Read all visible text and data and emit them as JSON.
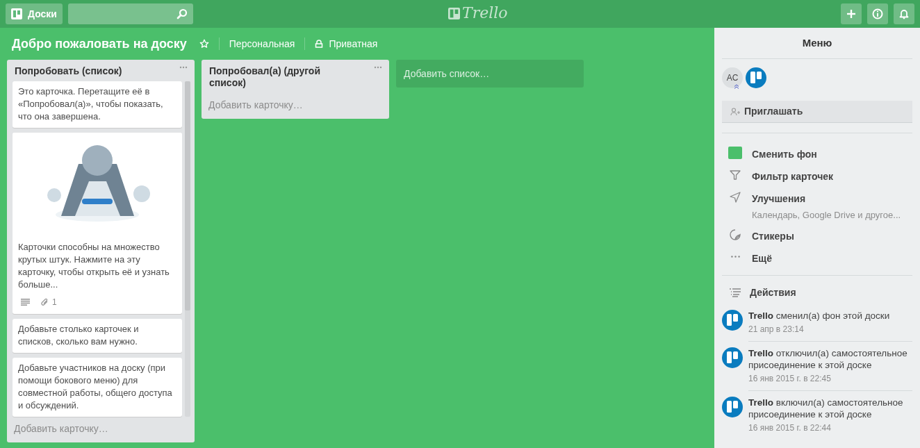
{
  "header": {
    "boards_button": "Доски",
    "logo": "Trello"
  },
  "board": {
    "title": "Добро пожаловать на доску",
    "team": "Персональная",
    "visibility": "Приватная"
  },
  "lists": [
    {
      "title": "Попробовать (список)",
      "cards": [
        {
          "kind": "text",
          "text": "Это карточка. Перетащите её в «Попробовал(а)», чтобы показать, что она завершена."
        },
        {
          "kind": "cover",
          "text": "Карточки способны на множество крутых штук. Нажмите на эту карточку, чтобы открыть её и узнать больше...",
          "description": true,
          "attachments": "1"
        },
        {
          "kind": "text",
          "text": "Добавьте столько карточек и списков, сколько вам нужно."
        },
        {
          "kind": "text",
          "text": "Добавьте участников на доску (при помощи бокового меню) для совместной работы, общего доступа и обсуждений."
        }
      ],
      "add_card": "Добавить карточку…"
    },
    {
      "title": "Попробовал(а) (другой список)",
      "add_card": "Добавить карточку…"
    }
  ],
  "add_list": "Добавить список…",
  "sidebar": {
    "title": "Меню",
    "members": [
      {
        "kind": "initials",
        "initials": "AC"
      },
      {
        "kind": "logo"
      }
    ],
    "invite": "Приглашать",
    "menu": [
      {
        "kind": "color",
        "label": "Сменить фон",
        "color": "#4bbf6b"
      },
      {
        "kind": "filter",
        "label": "Фильтр карточек"
      },
      {
        "kind": "powerups",
        "label": "Улучшения",
        "subtitle": "Календарь, Google Drive и другое..."
      },
      {
        "kind": "stickers",
        "label": "Стикеры"
      },
      {
        "kind": "more",
        "label": "Ещё"
      }
    ],
    "activity_title": "Действия",
    "activities": [
      {
        "author": "Trello",
        "text": "сменил(а) фон этой доски",
        "time": "21 апр в 23:14"
      },
      {
        "author": "Trello",
        "text": "отключил(а) самостоятельное присоединение к этой доске",
        "time": "16 янв 2015 г. в 22:45"
      },
      {
        "author": "Trello",
        "text": "включил(а) самостоятельное присоединение к этой доске",
        "time": "16 янв 2015 г. в 22:44"
      }
    ]
  }
}
